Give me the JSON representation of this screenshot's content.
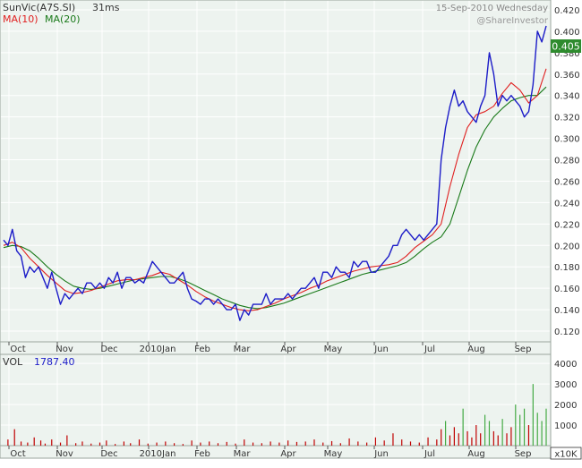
{
  "header": {
    "symbol": "SunVic(A7S.SI)",
    "period": "31ms",
    "date": "15-Sep-2010 Wednesday",
    "watermark": "@ShareInvestor"
  },
  "legend": [
    {
      "label": "MA(10)",
      "color": "#e02020"
    },
    {
      "label": "MA(20)",
      "color": "#1a7a1a"
    }
  ],
  "last_price_label": "0.405",
  "volume_panel": {
    "label": "VOL",
    "value": "1787.40",
    "unit": "x10K"
  },
  "colors": {
    "price": "#1c1cc8",
    "ma10": "#e02020",
    "ma20": "#1a7a1a",
    "volume": "#c00000",
    "volume_recent": "#44aa44",
    "plot_bg": "#edf3ef",
    "grid": "#ffffff",
    "frame": "#9aa69e",
    "price_tag": "#2e8b2e"
  },
  "chart_data": [
    {
      "type": "line",
      "title": "SunVic(A7S.SI)",
      "x_tick_labels": [
        "Oct",
        "Nov",
        "Dec",
        "2010Jan",
        "Feb",
        "Mar",
        "Apr",
        "May",
        "Jun",
        "Jul",
        "Aug",
        "Sep"
      ],
      "y_ticks": [
        "0.120",
        "0.140",
        "0.160",
        "0.180",
        "0.200",
        "0.220",
        "0.240",
        "0.260",
        "0.280",
        "0.300",
        "0.320",
        "0.340",
        "0.360",
        "0.380",
        "0.400",
        "0.420"
      ],
      "ylim": [
        0.11,
        0.425
      ],
      "xlim": [
        0,
        248
      ],
      "grid": true,
      "series": [
        {
          "name": "Price",
          "x": [
            0,
            2,
            4,
            6,
            8,
            10,
            12,
            14,
            16,
            18,
            20,
            22,
            24,
            26,
            28,
            30,
            32,
            34,
            36,
            38,
            40,
            42,
            44,
            46,
            48,
            50,
            52,
            54,
            56,
            58,
            60,
            62,
            64,
            66,
            68,
            70,
            72,
            74,
            76,
            78,
            80,
            82,
            84,
            86,
            88,
            90,
            92,
            94,
            96,
            98,
            100,
            102,
            104,
            106,
            108,
            110,
            112,
            114,
            116,
            118,
            120,
            122,
            124,
            126,
            128,
            130,
            132,
            134,
            136,
            138,
            140,
            142,
            144,
            146,
            148,
            150,
            152,
            154,
            156,
            158,
            160,
            162,
            164,
            166,
            168,
            170,
            172,
            174,
            176,
            178,
            180,
            182,
            184,
            186,
            188,
            190,
            192,
            194,
            196,
            198,
            200,
            202,
            204,
            206,
            208,
            210,
            212,
            214,
            216,
            218,
            220,
            222,
            224,
            226,
            228,
            230,
            232,
            234,
            236,
            238,
            240,
            242,
            244,
            246,
            248
          ],
          "values": [
            0.205,
            0.2,
            0.215,
            0.195,
            0.19,
            0.17,
            0.18,
            0.175,
            0.18,
            0.17,
            0.16,
            0.175,
            0.16,
            0.145,
            0.155,
            0.15,
            0.155,
            0.16,
            0.155,
            0.165,
            0.165,
            0.16,
            0.165,
            0.16,
            0.17,
            0.165,
            0.175,
            0.16,
            0.17,
            0.17,
            0.165,
            0.168,
            0.165,
            0.175,
            0.185,
            0.18,
            0.175,
            0.17,
            0.165,
            0.165,
            0.17,
            0.175,
            0.16,
            0.15,
            0.148,
            0.145,
            0.15,
            0.15,
            0.145,
            0.15,
            0.145,
            0.14,
            0.14,
            0.145,
            0.13,
            0.14,
            0.135,
            0.145,
            0.145,
            0.145,
            0.155,
            0.145,
            0.15,
            0.15,
            0.15,
            0.155,
            0.15,
            0.155,
            0.16,
            0.16,
            0.165,
            0.17,
            0.16,
            0.175,
            0.175,
            0.17,
            0.18,
            0.175,
            0.175,
            0.17,
            0.185,
            0.18,
            0.185,
            0.185,
            0.175,
            0.175,
            0.18,
            0.185,
            0.19,
            0.2,
            0.2,
            0.21,
            0.215,
            0.21,
            0.205,
            0.21,
            0.205,
            0.21,
            0.215,
            0.22,
            0.28,
            0.31,
            0.33,
            0.345,
            0.33,
            0.335,
            0.325,
            0.32,
            0.315,
            0.33,
            0.34,
            0.38,
            0.36,
            0.33,
            0.34,
            0.335,
            0.34,
            0.335,
            0.33,
            0.32,
            0.325,
            0.35,
            0.4,
            0.39,
            0.405
          ]
        },
        {
          "name": "MA(10)",
          "x": [
            0,
            4,
            8,
            12,
            16,
            20,
            24,
            28,
            32,
            36,
            40,
            44,
            48,
            52,
            56,
            60,
            64,
            68,
            72,
            76,
            80,
            84,
            88,
            92,
            96,
            100,
            104,
            108,
            112,
            116,
            120,
            124,
            128,
            132,
            136,
            140,
            144,
            148,
            152,
            156,
            160,
            164,
            168,
            172,
            176,
            180,
            184,
            188,
            192,
            196,
            200,
            204,
            208,
            212,
            216,
            220,
            224,
            228,
            232,
            236,
            240,
            244,
            248
          ],
          "values": [
            0.2,
            0.203,
            0.198,
            0.188,
            0.18,
            0.172,
            0.165,
            0.158,
            0.155,
            0.156,
            0.158,
            0.161,
            0.164,
            0.167,
            0.168,
            0.168,
            0.17,
            0.172,
            0.175,
            0.173,
            0.168,
            0.163,
            0.157,
            0.152,
            0.148,
            0.145,
            0.142,
            0.14,
            0.139,
            0.14,
            0.143,
            0.146,
            0.15,
            0.153,
            0.156,
            0.16,
            0.163,
            0.167,
            0.17,
            0.173,
            0.176,
            0.178,
            0.18,
            0.181,
            0.182,
            0.184,
            0.19,
            0.198,
            0.204,
            0.21,
            0.22,
            0.255,
            0.285,
            0.31,
            0.322,
            0.325,
            0.33,
            0.342,
            0.352,
            0.345,
            0.333,
            0.34,
            0.365
          ]
        },
        {
          "name": "MA(20)",
          "x": [
            0,
            4,
            8,
            12,
            16,
            20,
            24,
            28,
            32,
            36,
            40,
            44,
            48,
            52,
            56,
            60,
            64,
            68,
            72,
            76,
            80,
            84,
            88,
            92,
            96,
            100,
            104,
            108,
            112,
            116,
            120,
            124,
            128,
            132,
            136,
            140,
            144,
            148,
            152,
            156,
            160,
            164,
            168,
            172,
            176,
            180,
            184,
            188,
            192,
            196,
            200,
            204,
            208,
            212,
            216,
            220,
            224,
            228,
            232,
            236,
            240,
            244,
            248
          ],
          "values": [
            0.198,
            0.2,
            0.199,
            0.195,
            0.188,
            0.18,
            0.173,
            0.167,
            0.162,
            0.16,
            0.159,
            0.16,
            0.162,
            0.164,
            0.166,
            0.168,
            0.169,
            0.17,
            0.171,
            0.171,
            0.169,
            0.166,
            0.162,
            0.158,
            0.154,
            0.15,
            0.147,
            0.144,
            0.142,
            0.141,
            0.142,
            0.144,
            0.146,
            0.149,
            0.152,
            0.155,
            0.158,
            0.161,
            0.164,
            0.167,
            0.17,
            0.173,
            0.175,
            0.177,
            0.179,
            0.181,
            0.184,
            0.19,
            0.197,
            0.203,
            0.208,
            0.22,
            0.245,
            0.27,
            0.292,
            0.308,
            0.32,
            0.328,
            0.335,
            0.338,
            0.34,
            0.34,
            0.348
          ]
        }
      ]
    },
    {
      "type": "bar",
      "title": "VOL",
      "y_ticks": [
        "1000",
        "2000",
        "3000",
        "4000"
      ],
      "ylim": [
        0,
        4400
      ],
      "xlim": [
        0,
        248
      ],
      "x": [
        2,
        5,
        8,
        11,
        14,
        17,
        19,
        22,
        26,
        29,
        33,
        36,
        40,
        44,
        47,
        51,
        55,
        58,
        62,
        66,
        70,
        74,
        78,
        82,
        86,
        90,
        94,
        98,
        102,
        106,
        110,
        114,
        118,
        122,
        126,
        130,
        134,
        138,
        142,
        146,
        150,
        154,
        158,
        162,
        166,
        170,
        174,
        178,
        182,
        186,
        190,
        194,
        198,
        200,
        202,
        204,
        206,
        208,
        210,
        212,
        214,
        216,
        218,
        220,
        222,
        224,
        226,
        228,
        230,
        232,
        234,
        236,
        238,
        240,
        242,
        244,
        246,
        248
      ],
      "values": [
        300,
        800,
        200,
        150,
        400,
        250,
        100,
        300,
        150,
        500,
        120,
        200,
        100,
        150,
        250,
        80,
        200,
        120,
        300,
        100,
        150,
        200,
        120,
        80,
        250,
        150,
        200,
        120,
        180,
        100,
        300,
        150,
        120,
        200,
        150,
        250,
        180,
        200,
        300,
        150,
        220,
        120,
        350,
        200,
        150,
        400,
        250,
        600,
        300,
        200,
        150,
        400,
        300,
        800,
        1200,
        500,
        900,
        600,
        1800,
        700,
        400,
        1000,
        600,
        1500,
        1200,
        700,
        500,
        1300,
        600,
        900,
        2000,
        1500,
        1800,
        1000,
        3000,
        1600,
        1200,
        1800
      ]
    }
  ]
}
